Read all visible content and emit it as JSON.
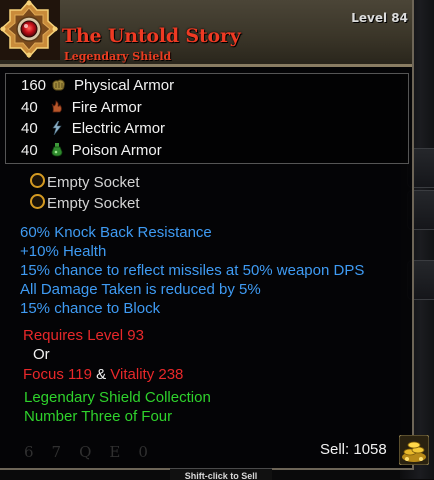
{
  "item": {
    "name": "The Untold Story",
    "type": "Legendary Shield",
    "level_label": "Level 84",
    "icon": "ornate-shield-icon"
  },
  "stats": [
    {
      "value": "160",
      "label": "Physical Armor",
      "icon": "physical-armor-icon"
    },
    {
      "value": "40",
      "label": "Fire Armor",
      "icon": "fire-armor-icon"
    },
    {
      "value": "40",
      "label": "Electric Armor",
      "icon": "electric-armor-icon"
    },
    {
      "value": "40",
      "label": "Poison Armor",
      "icon": "poison-armor-icon"
    }
  ],
  "sockets": [
    "Empty Socket",
    "Empty Socket"
  ],
  "effects": [
    "60% Knock Back Resistance",
    "+10% Health",
    "15% chance to reflect missiles at 50% weapon DPS",
    "All Damage Taken is reduced by 5%",
    "15% chance to Block"
  ],
  "requirements": {
    "level": "Requires Level 93",
    "or": "Or",
    "focus": "Focus 119",
    "and": "&",
    "vitality": "Vitality 238"
  },
  "set": {
    "collection": "Legendary Shield Collection",
    "number": "Number Three of Four"
  },
  "sell": {
    "label": "Sell: 1058",
    "icon": "gold-pile-icon"
  },
  "hint": "Shift-click to Sell",
  "background_hotkeys": [
    "6",
    "7",
    "Q",
    "E",
    "0"
  ],
  "colors": {
    "name": "#ef3a23",
    "effect": "#3f9bf3",
    "requirement": "#e8282a",
    "set": "#2fd22c"
  }
}
